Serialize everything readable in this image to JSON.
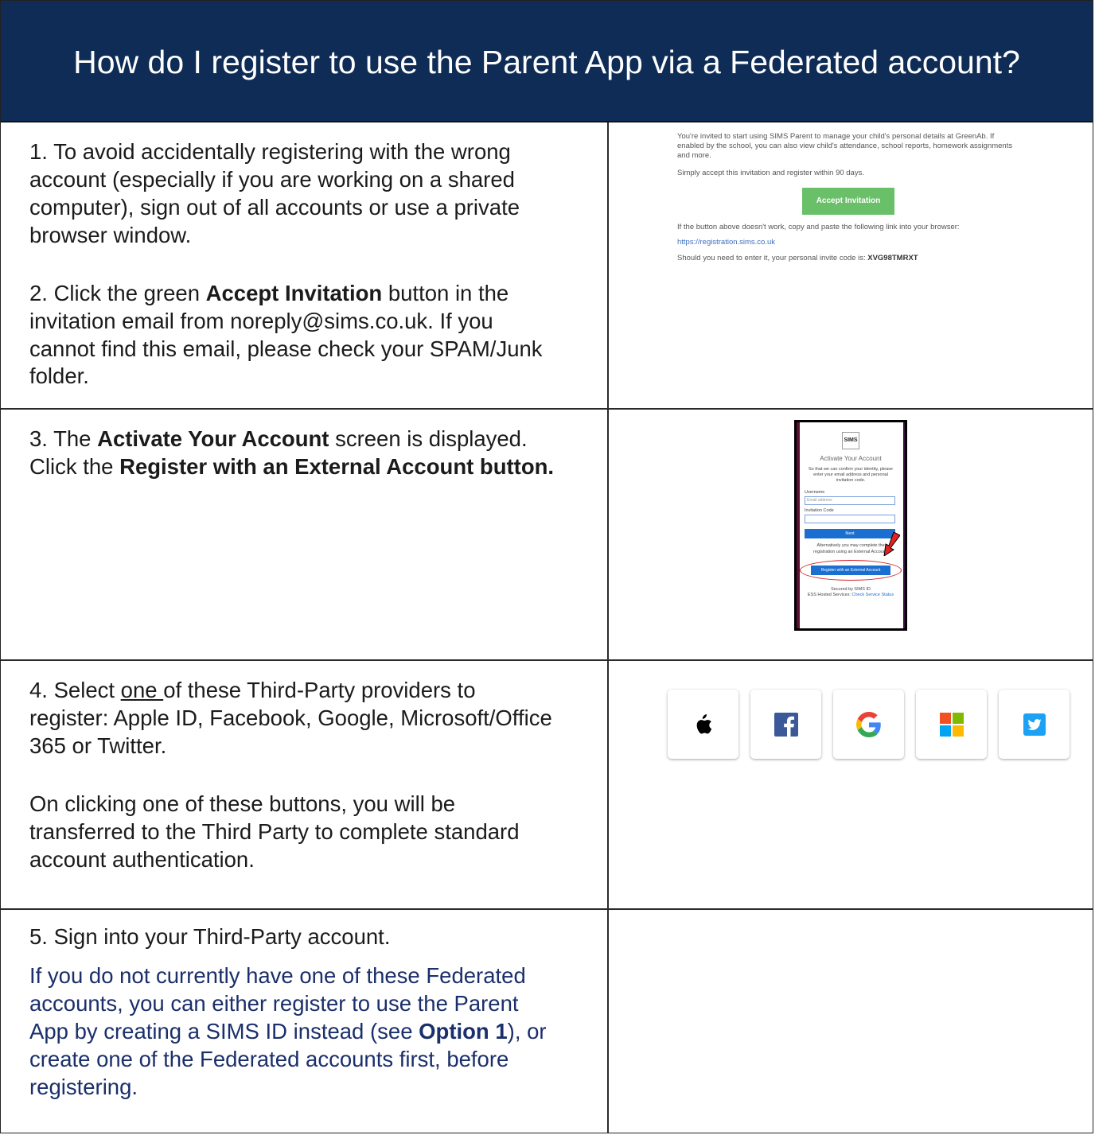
{
  "header": {
    "title": "How do I register to use the Parent App via a Federated account?"
  },
  "steps": {
    "s1": "1. To avoid accidentally registering with the wrong  account (especially if you are working on a shared  computer), sign out of all accounts or use a private  browser window.",
    "s2_a": "2. Click the green ",
    "s2_b": "Accept Invitation",
    "s2_c": " button in the  invitation email from noreply@sims.co.uk. If you  cannot find this email, please check your SPAM/Junk  folder.",
    "s3_a": "3. The ",
    "s3_b": "Activate Your Account",
    "s3_c": " screen is displayed. Click the ",
    "s3_d": "Register with an External Account button.",
    "s4_a": "4. Select ",
    "s4_b": "one ",
    "s4_c": "of these Third-Party providers to register:  Apple ID, Facebook, Google, Microsoft/Office 365 or  Twitter.",
    "s4_p2": "On clicking one of these buttons, you will be transferred to the Third Party to complete standard  account authentication.",
    "s5": "5. Sign into your Third-Party account.",
    "s5_note_a": "If you do not currently have one of these Federated  accounts, you can either register to use the Parent App  by creating a SIMS ID instead (see ",
    "s5_note_b": "Option 1",
    "s5_note_c": "), or  create one of the Federated accounts first, before  registering."
  },
  "email_preview": {
    "intro": "You're invited to start using SIMS Parent to manage your child's personal details at GreenAb. If enabled by the school, you can also view child's attendance, school reports, homework assignments and more.",
    "accept_note": "Simply accept this invitation and register within 90 days.",
    "button": "Accept Invitation",
    "fallback": "If the button above doesn't work, copy and paste the following link into your browser:",
    "link": "https://registration.sims.co.uk",
    "code_text": "Should you need to enter it, your personal invite code is:",
    "code": "XVG98TMRXT"
  },
  "activate_preview": {
    "logo": "SIMS",
    "title": "Activate Your Account",
    "desc": "So that we can confirm your identity, please enter your email address and personal invitation code.",
    "username_label": "Username",
    "username_placeholder": "Email address",
    "code_label": "Invitation Code",
    "next": "Next",
    "alt": "Alternatively you may complete the registration using an External Account.",
    "external_button": "Register with an External Account",
    "secured": "Secured by SIMS ID",
    "hosted": "ESS Hosted Services:",
    "status_link": "Check Service Status"
  },
  "providers": [
    "Apple ID",
    "Facebook",
    "Google",
    "Microsoft",
    "Twitter"
  ],
  "colors": {
    "header_bg": "#0e2c55",
    "note_text": "#1a2f6b",
    "facebook": "#3b5998",
    "twitter": "#1da1f2"
  }
}
